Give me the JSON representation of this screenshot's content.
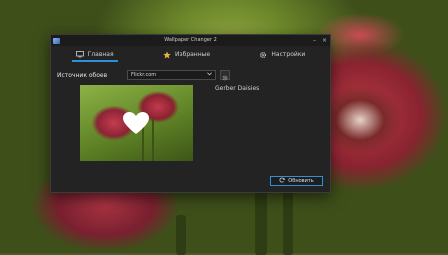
{
  "window": {
    "title": "Wallpaper Changer 2",
    "controls": {
      "minimize": "–",
      "close": "×"
    }
  },
  "tabs": [
    {
      "label": "Главная",
      "icon": "monitor-icon",
      "active": true
    },
    {
      "label": "Избранные",
      "icon": "star-icon",
      "active": false
    },
    {
      "label": "Настройки",
      "icon": "gear-icon",
      "active": false
    }
  ],
  "source": {
    "label": "Источник обоев",
    "selected": "Flickr.com",
    "settings_icon": "gear-icon"
  },
  "preview": {
    "wallpaper_name": "Gerber Daisies",
    "favorite_icon": "heart-icon"
  },
  "refresh_button": {
    "label": "Обновить",
    "icon": "refresh-icon"
  },
  "colors": {
    "accent": "#2f8fd8",
    "window_bg": "#232323",
    "titlebar_bg": "#1b1b1b"
  }
}
